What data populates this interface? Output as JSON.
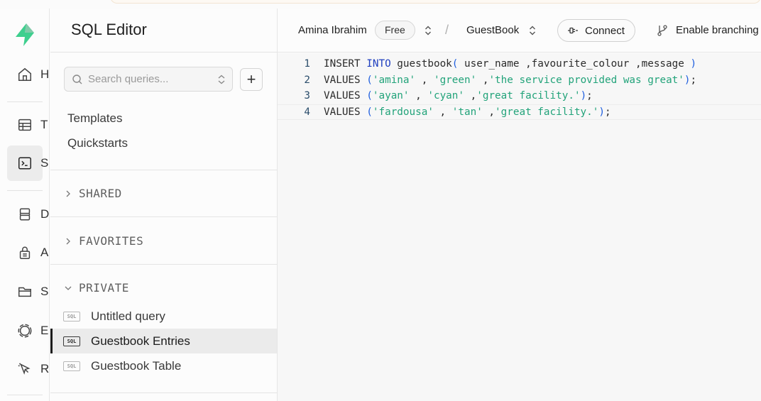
{
  "sidebar_rail": {
    "items": [
      {
        "id": "home",
        "icon": "home-icon",
        "label": "H"
      },
      {
        "id": "table-editor",
        "icon": "table-icon",
        "label": "T"
      },
      {
        "id": "sql-editor",
        "icon": "terminal-icon",
        "label": "S",
        "active": true
      },
      {
        "id": "database",
        "icon": "database-icon",
        "label": "D"
      },
      {
        "id": "auth",
        "icon": "lock-icon",
        "label": "A"
      },
      {
        "id": "storage",
        "icon": "folder-icon",
        "label": "S"
      },
      {
        "id": "edge-functions",
        "icon": "edge-functions-icon",
        "label": "E"
      },
      {
        "id": "realtime",
        "icon": "cursor-icon",
        "label": "R"
      }
    ]
  },
  "explorer": {
    "title": "SQL Editor",
    "search_placeholder": "Search queries...",
    "add_label": "+",
    "links": [
      "Templates",
      "Quickstarts"
    ],
    "sections": {
      "shared": "SHARED",
      "favorites": "FAVORITES",
      "private": "PRIVATE"
    },
    "badge": "SQL",
    "queries": [
      {
        "label": "Untitled query",
        "active": false
      },
      {
        "label": "Guestbook Entries",
        "active": true
      },
      {
        "label": "Guestbook Table",
        "active": false
      }
    ]
  },
  "header": {
    "org": "Amina Ibrahim",
    "plan": "Free",
    "separator": "/",
    "project": "GuestBook",
    "connect_label": "Connect",
    "branching_label": "Enable branching"
  },
  "editor": {
    "lines": [
      {
        "num": "1",
        "tokens": [
          [
            "plain",
            "INSERT "
          ],
          [
            "kw",
            "INTO"
          ],
          [
            "plain",
            " guestbook"
          ],
          [
            "paren",
            "("
          ],
          [
            "plain",
            " user_name ,favourite_colour ,message "
          ],
          [
            "paren",
            ")"
          ]
        ]
      },
      {
        "num": "2",
        "tokens": [
          [
            "plain",
            "VALUES "
          ],
          [
            "paren",
            "("
          ],
          [
            "str",
            "'amina'"
          ],
          [
            "plain",
            " , "
          ],
          [
            "str",
            "'green'"
          ],
          [
            "plain",
            " ,"
          ],
          [
            "str",
            "'the service provided was great'"
          ],
          [
            "paren",
            ")"
          ],
          [
            "plain",
            ";"
          ]
        ]
      },
      {
        "num": "3",
        "tokens": [
          [
            "plain",
            "VALUES "
          ],
          [
            "paren",
            "("
          ],
          [
            "str",
            "'ayan'"
          ],
          [
            "plain",
            " , "
          ],
          [
            "str",
            "'cyan'"
          ],
          [
            "plain",
            " ,"
          ],
          [
            "str",
            "'great facility.'"
          ],
          [
            "paren",
            ")"
          ],
          [
            "plain",
            ";"
          ]
        ]
      },
      {
        "num": "4",
        "tokens": [
          [
            "plain",
            "VALUES "
          ],
          [
            "paren",
            "("
          ],
          [
            "str",
            "'fardousa'"
          ],
          [
            "plain",
            " , "
          ],
          [
            "str",
            "'tan'"
          ],
          [
            "plain",
            " ,"
          ],
          [
            "str",
            "'great facility.'"
          ],
          [
            "paren",
            ")"
          ],
          [
            "plain",
            ";"
          ]
        ],
        "current": true
      }
    ]
  },
  "colors": {
    "brand": "#3ecf8e",
    "keyword": "#1f3fbf",
    "string": "#22a37a",
    "paren": "#1f5fdf"
  }
}
